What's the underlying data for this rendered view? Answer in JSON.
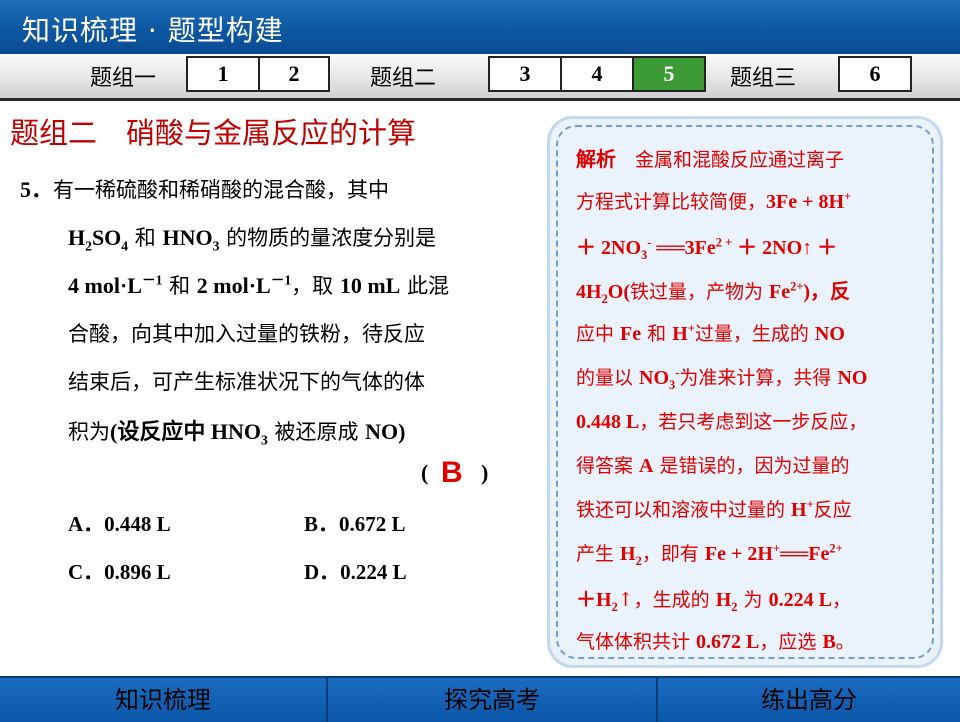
{
  "header": {
    "title": "知识梳理 · 题型构建"
  },
  "nav": {
    "group1": "题组一",
    "group2": "题组二",
    "group3": "题组三",
    "items": [
      "1",
      "2",
      "3",
      "4",
      "5",
      "6"
    ],
    "active": "5"
  },
  "section": {
    "title": "题组二　硝酸与金属反应的计算"
  },
  "question": {
    "number": "5．",
    "l1": "有一稀硫酸和稀硝酸的混合酸，其中",
    "h2so4": "H",
    "h2so4_sub1": "2",
    "h2so4_mid": "SO",
    "h2so4_sub2": "4",
    "l2a": " 和 ",
    "hno3": "HNO",
    "hno3_sub": "3",
    "l2b": " 的物质的量浓度分别是",
    "c1": "4 mol·L",
    "c1_sup": "－1",
    "l3a": " 和 ",
    "c2": "2 mol·L",
    "c2_sup": "－1",
    "l3b": "，取 ",
    "vol": "10 mL",
    "l3c": " 此混",
    "l4": "合酸，向其中加入过量的铁粉，待反应",
    "l5": "结束后，可产生标准状况下的气体的体",
    "l6a": "积为",
    "l6b": "(设反应中 ",
    "hno3b": "HNO",
    "hno3b_sub": "3",
    "l6c": " 被还原成 ",
    "no": "NO)",
    "paren_open": "(",
    "answer": "B",
    "paren_close": ")",
    "options": {
      "a": "A．0.448 L",
      "b": "B．0.672 L",
      "c": "C．0.896 L",
      "d": "D．0.224 L"
    }
  },
  "explanation": {
    "label": "解析",
    "l1": "金属和混酸反应通过离子",
    "l2a": "方程式计算比较简便，",
    "l2b": "3Fe + 8H",
    "l2b_sup": "+",
    "l3a": "＋ 2NO",
    "l3a_sub": "3",
    "l3a_sup": "-",
    "l3b": " ══3Fe",
    "l3b_sup": "2 +",
    "l3c": " ＋ 2NO↑ ＋",
    "l4a": "4H",
    "l4a_sub": "2",
    "l4b": "O(",
    "l4c": "铁过量，产物为 ",
    "l4d": "Fe",
    "l4d_sup": "2+",
    "l4e": ")，反",
    "l5a": "应中 ",
    "l5b": "Fe",
    "l5c": " 和 ",
    "l5d": "H",
    "l5d_sup": "+",
    "l5e": "过量，生成的 ",
    "l5f": "NO",
    "l6a": "的量以 ",
    "l6b": "NO",
    "l6b_sub": "3",
    "l6b_sup": "-",
    "l6c": "为准来计算，共得 ",
    "l6d": "NO",
    "l7a": "0.448 L",
    "l7b": "，若只考虑到这一步反应，",
    "l8a": "得答案 ",
    "l8b": "A",
    "l8c": " 是错误的，因为过量的",
    "l9a": "铁还可以和溶液中过量的 ",
    "l9b": "H",
    "l9b_sup": "+",
    "l9c": "反应",
    "l10a": "产生 ",
    "l10b": "H",
    "l10b_sub": "2",
    "l10c": "，即有 ",
    "l10d": "Fe + 2H",
    "l10d_sup": "+",
    "l10e": "══Fe",
    "l10e_sup": "2+",
    "l11a": "＋H",
    "l11a_sub": "2",
    "l11b": "↑，生成的 ",
    "l11c": "H",
    "l11c_sub": "2",
    "l11d": " 为 ",
    "l11e": "0.224 L",
    "l11f": "，",
    "l12a": "气体体积共计 ",
    "l12b": "0.672 L",
    "l12c": "，应选 ",
    "l12d": "B",
    "l12e": "。"
  },
  "footer": {
    "b1": "知识梳理",
    "b2": "探究高考",
    "b3": "练出高分"
  }
}
